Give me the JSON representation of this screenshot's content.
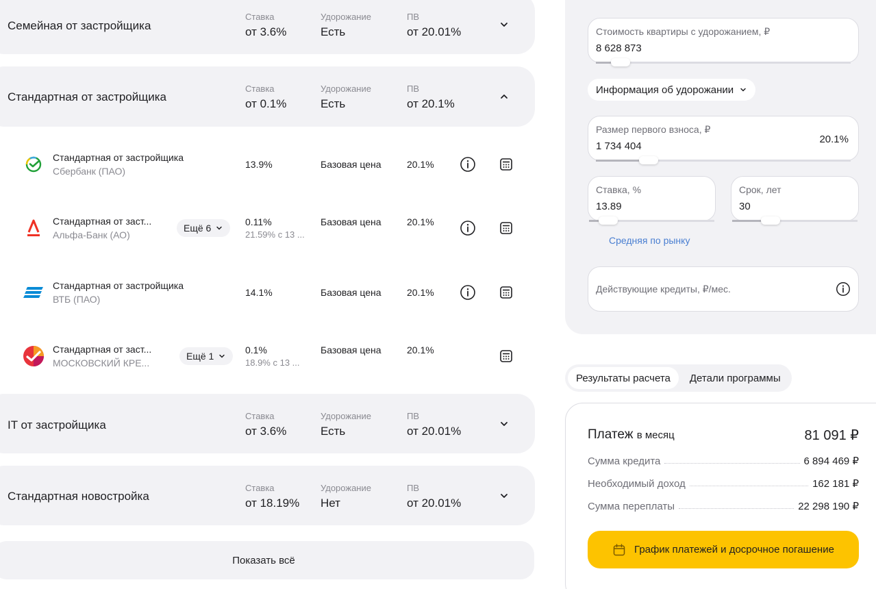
{
  "programs": [
    {
      "name": "Семейная от застройщика",
      "rate_label": "Ставка",
      "rate": "от 3.6%",
      "markup_label": "Удорожание",
      "markup": "Есть",
      "pv_label": "ПВ",
      "pv": "от 20.01%",
      "expanded": false
    },
    {
      "name": "Стандартная от застройщика",
      "rate_label": "Ставка",
      "rate": "от 0.1%",
      "markup_label": "Удорожание",
      "markup": "Есть",
      "pv_label": "ПВ",
      "pv": "от 20.1%",
      "expanded": true
    },
    {
      "name": "IT от застройщика",
      "rate_label": "Ставка",
      "rate": "от 3.6%",
      "markup_label": "Удорожание",
      "markup": "Есть",
      "pv_label": "ПВ",
      "pv": "от 20.01%",
      "expanded": false
    },
    {
      "name": "Стандартная новостройка",
      "rate_label": "Ставка",
      "rate": "от 18.19%",
      "markup_label": "Удорожание",
      "markup": "Нет",
      "pv_label": "ПВ",
      "pv": "от 20.01%",
      "expanded": false
    }
  ],
  "offers": [
    {
      "program": "Стандартная от застройщика",
      "bank": "Сбербанк (ПАО)",
      "rate": "13.9%",
      "rate_sub": "",
      "price": "Базовая цена",
      "pv": "20.1%",
      "more": "",
      "logo": "sber-logo"
    },
    {
      "program": "Стандартная от заст...",
      "bank": "Альфа-Банк (АО)",
      "rate": "0.11%",
      "rate_sub": "21.59% с 13 ...",
      "price": "Базовая цена",
      "pv": "20.1%",
      "more": "Ещё 6",
      "logo": "alfa-logo"
    },
    {
      "program": "Стандартная от застройщика",
      "bank": "ВТБ (ПАО)",
      "rate": "14.1%",
      "rate_sub": "",
      "price": "Базовая цена",
      "pv": "20.1%",
      "more": "",
      "logo": "vtb-logo"
    },
    {
      "program": "Стандартная от заст...",
      "bank": "МОСКОВСКИЙ КРЕ...",
      "rate": "0.1%",
      "rate_sub": "18.9% с 13 ...",
      "price": "Базовая цена",
      "pv": "20.1%",
      "more": "Ещё 1",
      "logo": "mkb-logo"
    }
  ],
  "show_all": "Показать всё",
  "calculator": {
    "price_label": "Стоимость квартиры с удорожанием, ₽",
    "price_value": "8 628 873",
    "markup_info": "Информация об удорожании",
    "down_label": "Размер первого взноса, ₽",
    "down_value": "1 734 404",
    "down_percent": "20.1%",
    "rate_label": "Ставка, %",
    "rate_value": "13.89",
    "term_label": "Срок, лет",
    "term_value": "30",
    "market_link": "Средняя по рынку",
    "credits_placeholder": "Действующие кредиты, ₽/мес."
  },
  "tabs": [
    "Результаты расчета",
    "Детали программы"
  ],
  "results": {
    "title": "Платеж",
    "title_small": "в месяц",
    "monthly": "81 091 ₽",
    "rows": [
      {
        "label": "Сумма кредита",
        "value": "6 894 469 ₽"
      },
      {
        "label": "Необходимый доход",
        "value": "162 181 ₽"
      },
      {
        "label": "Сумма переплаты",
        "value": "22 298 190 ₽"
      }
    ],
    "cta": "График платежей и досрочное погашение"
  },
  "colors": {
    "accent_yellow": "#fdc300",
    "link_blue": "#4a7fd1",
    "surface": "#f2f2f5",
    "alfa_red": "#ef3124",
    "vtb_blue": "#0a8bd6"
  }
}
